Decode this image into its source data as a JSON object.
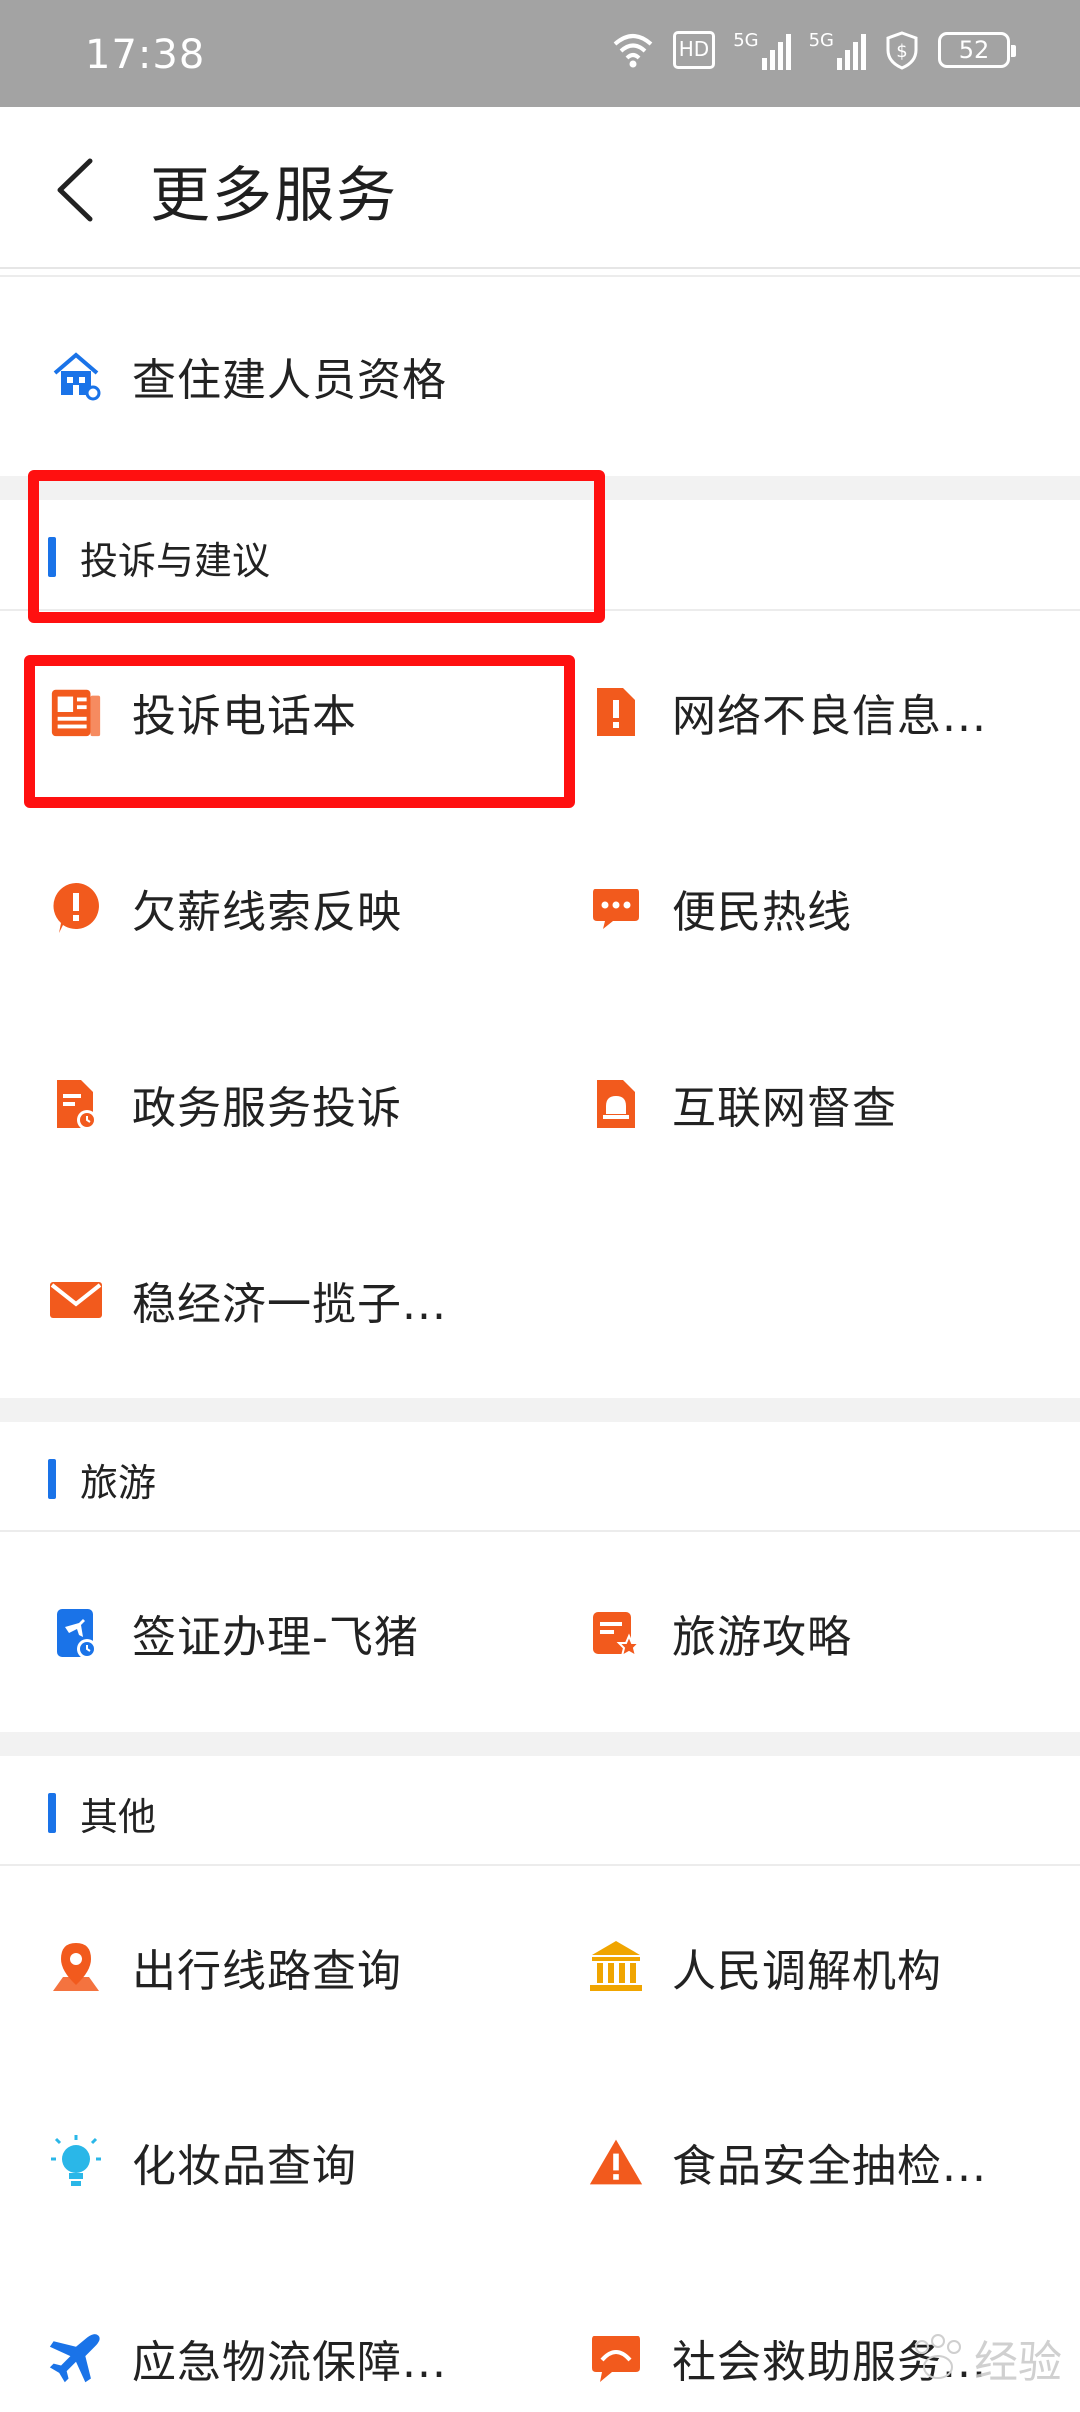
{
  "status_bar": {
    "time": "17:38",
    "hd_label": "HD",
    "net1": "5G",
    "net2": "5G",
    "battery": "52"
  },
  "header": {
    "title": "更多服务"
  },
  "top_item": {
    "label": "查住建人员资格"
  },
  "sections": {
    "complaints": {
      "title": "投诉与建议",
      "items": [
        {
          "label": "投诉电话本"
        },
        {
          "label": "网络不良信息..."
        },
        {
          "label": "欠薪线索反映"
        },
        {
          "label": "便民热线"
        },
        {
          "label": "政务服务投诉"
        },
        {
          "label": "互联网督查"
        },
        {
          "label": "稳经济一揽子..."
        }
      ]
    },
    "travel": {
      "title": "旅游",
      "items": [
        {
          "label": "签证办理-飞猪"
        },
        {
          "label": "旅游攻略"
        }
      ]
    },
    "other": {
      "title": "其他",
      "items": [
        {
          "label": "出行线路查询"
        },
        {
          "label": "人民调解机构"
        },
        {
          "label": "化妆品查询"
        },
        {
          "label": "食品安全抽检..."
        },
        {
          "label": "应急物流保障..."
        },
        {
          "label": "社会救助服务..."
        }
      ]
    }
  },
  "watermark": {
    "text": "经验"
  },
  "colors": {
    "accent": "#1a73e8",
    "orange": "#f25a1d",
    "highlight": "#ff1010"
  }
}
